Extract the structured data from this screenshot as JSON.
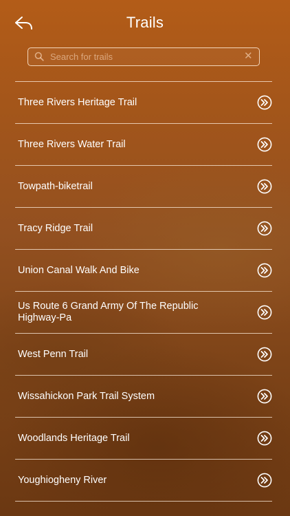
{
  "header": {
    "title": "Trails",
    "back_icon": "back-arrow-icon"
  },
  "search": {
    "placeholder": "Search for trails",
    "value": "",
    "icon": "search-icon",
    "clear_icon": "clear-icon"
  },
  "trails": {
    "items": [
      {
        "label": "Three Rivers Heritage Trail"
      },
      {
        "label": "Three Rivers Water Trail"
      },
      {
        "label": "Towpath-biketrail"
      },
      {
        "label": "Tracy Ridge Trail"
      },
      {
        "label": "Union Canal Walk And Bike"
      },
      {
        "label": "Us Route 6 Grand Army Of The Republic Highway-Pa"
      },
      {
        "label": "West Penn Trail"
      },
      {
        "label": "Wissahickon Park Trail System"
      },
      {
        "label": "Woodlands Heritage Trail"
      },
      {
        "label": "Youghiogheny River"
      }
    ],
    "row_icon": "double-chevron-right-icon"
  },
  "colors": {
    "background": "#a4561a",
    "text": "#ffffff",
    "divider": "#fff0e1"
  }
}
